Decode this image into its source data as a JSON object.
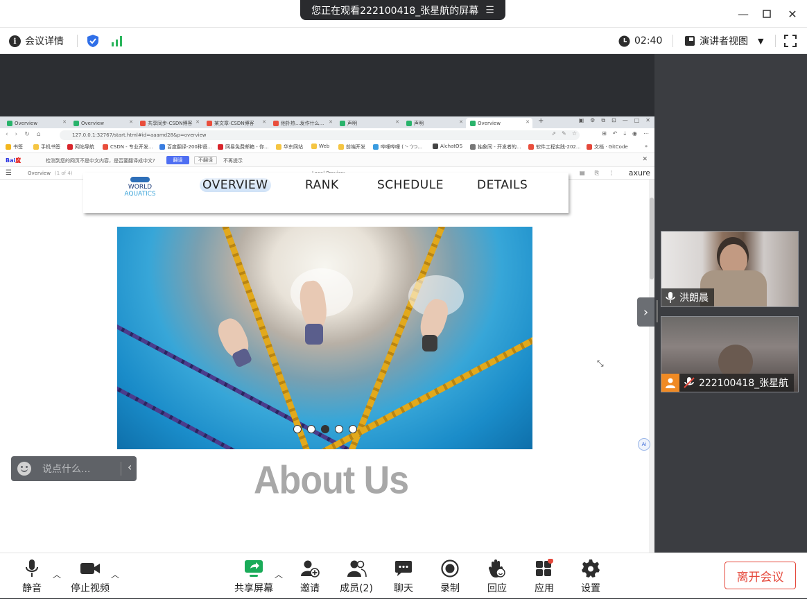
{
  "window": {
    "share_banner": "您正在观看222100418_张星航的屏幕",
    "controls": [
      "minimize",
      "maximize",
      "close"
    ]
  },
  "infobar": {
    "meeting_details": "会议详情",
    "timer": "02:40",
    "view_mode": "演讲者视图"
  },
  "browser": {
    "tabs": [
      {
        "label": "Overview",
        "color": "#29b36b"
      },
      {
        "label": "Overview",
        "color": "#29b36b"
      },
      {
        "label": "共享同步-CSDN博客",
        "color": "#e94e3c"
      },
      {
        "label": "某文章-CSDN博客",
        "color": "#e94e3c"
      },
      {
        "label": "他扑热...发作什么...",
        "color": "#e94e3c"
      },
      {
        "label": "声明",
        "color": "#29b36b"
      },
      {
        "label": "声明",
        "color": "#29b36b"
      },
      {
        "label": "Overview",
        "color": "#29b36b"
      }
    ],
    "address": "127.0.0.1:32767/start.html#id=aaamd28&p=overview",
    "bookmarks": [
      "书签",
      "手机书签",
      "网站导航",
      "CSDN - 专业开发...",
      "百度翻译-200种语...",
      "网易免费邮箱 - 你...",
      "华东网站",
      "Web",
      "前端开发",
      "哔哩哔哩 ( '- ')つ...",
      "AlchatOS",
      "抽象同 - 开发者的...",
      "软件工程实践-202...",
      "文档 · GitCode"
    ],
    "baidu_bar": {
      "logo_a": "Bai",
      "logo_b": "度",
      "message": "检测到您的网页不是中文内容，是否要翻译成中文?",
      "translate": "翻译",
      "no_translate": "不翻译",
      "never": "不再提示"
    },
    "axure": {
      "page_name": "Overview",
      "page_count": "(1 of 4)",
      "preview_label": "Local Preview",
      "brand": "axure"
    }
  },
  "site": {
    "logo_line1": "WORLD",
    "logo_line2": "AQUATICS",
    "nav": [
      "OVERVIEW",
      "RANK",
      "SCHEDULE",
      "DETAILS"
    ],
    "active_nav": "OVERVIEW",
    "slides": 5,
    "active_slide": 3,
    "about_heading": "About Us",
    "ai_badge": "Ai"
  },
  "chat": {
    "placeholder": "说点什么..."
  },
  "participants": [
    {
      "name": "洪朗晨",
      "mic": "on"
    },
    {
      "name": "222100418_张星航",
      "mic": "muted"
    }
  ],
  "toolbar": {
    "mute": "静音",
    "stop_video": "停止视频",
    "share_screen": "共享屏幕",
    "invite": "邀请",
    "members": "成员(2)",
    "chat": "聊天",
    "record": "录制",
    "reactions": "回应",
    "apps": "应用",
    "settings": "设置",
    "leave": "离开会议"
  },
  "colors": {
    "leave_red": "#e5483b",
    "share_green": "#1aab59",
    "shield_blue": "#2f6fe8",
    "signal_green": "#2bb55c"
  }
}
